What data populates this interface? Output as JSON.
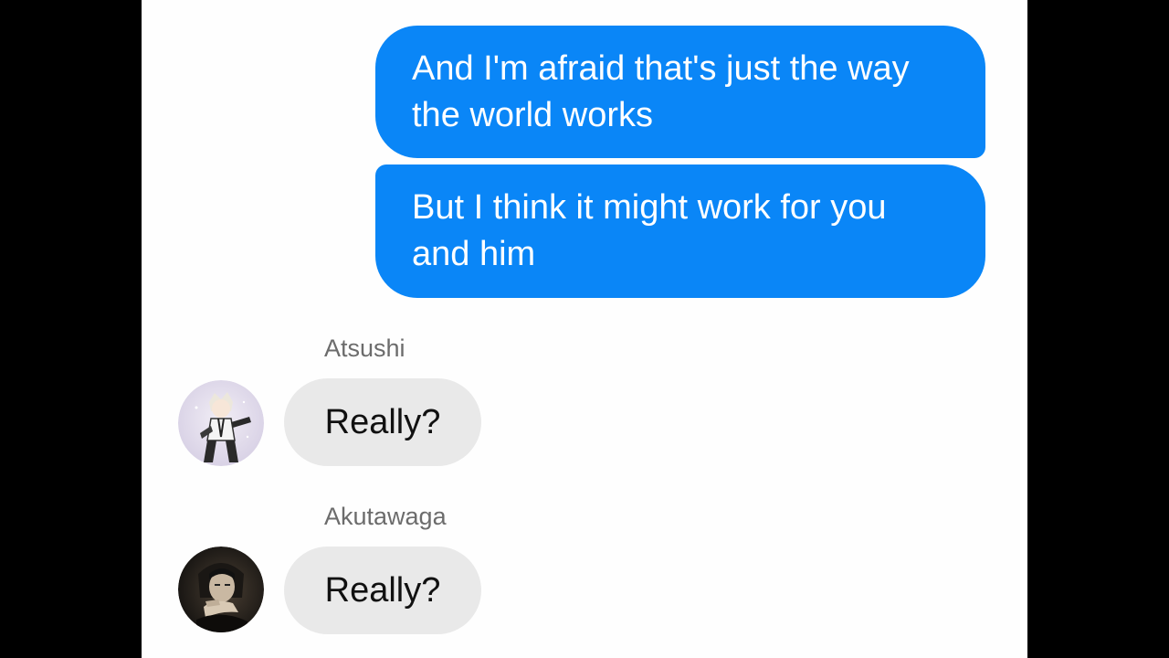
{
  "conversation": {
    "outgoing": [
      {
        "text": "And I'm afraid that's just the way the world works"
      },
      {
        "text": "But I think it might work for you and him"
      }
    ],
    "incoming": [
      {
        "sender": "Atsushi",
        "text": "Really?",
        "avatar": "atsushi-avatar"
      },
      {
        "sender": "Akutawaga",
        "text": "Really?",
        "avatar": "akutawaga-avatar"
      }
    ]
  },
  "colors": {
    "outgoing_bubble": "#0a86f7",
    "incoming_bubble": "#e9e9e9",
    "background": "#fefefe",
    "letterbox": "#000000"
  }
}
